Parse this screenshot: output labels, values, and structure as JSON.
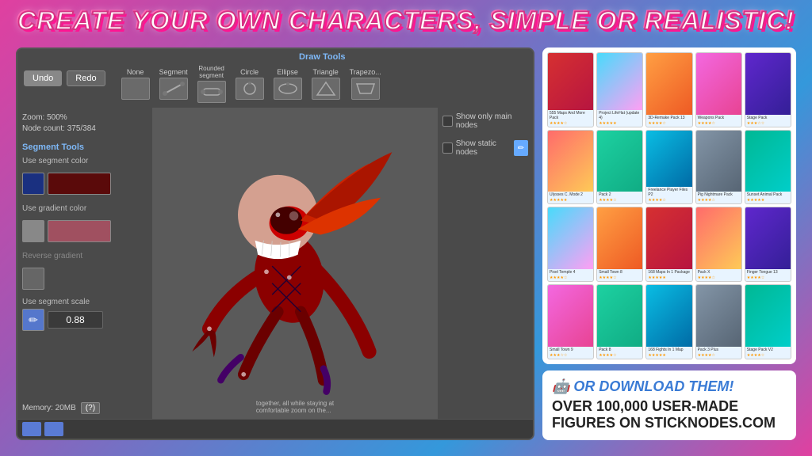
{
  "title": "CREATE YOUR OWN CHARACTERS, SIMPLE OR REALISTIC!",
  "app": {
    "toolbar": {
      "undo_label": "Undo",
      "redo_label": "Redo",
      "zoom_label": "Zoom: 500%",
      "node_count_label": "Node count: 375/384"
    },
    "draw_tools": {
      "section_label": "Draw Tools",
      "tools": [
        {
          "name": "None",
          "id": "tool-none"
        },
        {
          "name": "Segment",
          "id": "tool-segment"
        },
        {
          "name": "Rounded segment",
          "id": "tool-rounded-segment"
        },
        {
          "name": "Circle",
          "id": "tool-circle"
        },
        {
          "name": "Ellipse",
          "id": "tool-ellipse"
        },
        {
          "name": "Triangle",
          "id": "tool-triangle"
        },
        {
          "name": "Trapezoid",
          "id": "tool-trapezoid"
        }
      ]
    },
    "right_panel": {
      "show_main_nodes_label": "Show only main nodes",
      "show_static_nodes_label": "Show static nodes"
    },
    "left_panel": {
      "segment_tools_label": "Segment Tools",
      "use_segment_color_label": "Use segment color",
      "use_gradient_color_label": "Use gradient color",
      "reverse_gradient_label": "Reverse gradient",
      "use_segment_scale_label": "Use segment scale",
      "scale_value": "0.88",
      "memory_label": "Memory: 20MB",
      "help_label": "(?)"
    }
  },
  "community": {
    "download_title": "🤖 OR DOWNLOAD THEM!",
    "download_body": "OVER 100,000 USER-MADE FIGURES ON STICKNODES.COM",
    "cards": [
      {
        "title": "555 Maps And More Pack",
        "stars": "★★★★☆",
        "bg": "card-bg-9"
      },
      {
        "title": "Project LifeHat (update 4)",
        "stars": "★★★★★",
        "bg": "card-bg-2"
      },
      {
        "title": "3D-Remake Pack 13",
        "stars": "★★★★☆",
        "bg": "card-bg-5"
      },
      {
        "title": "Weapons Pack",
        "stars": "★★★★☆",
        "bg": "card-bg-7"
      },
      {
        "title": "Stage Pack",
        "stars": "★★★☆☆",
        "bg": "card-bg-4"
      },
      {
        "title": "Ulysses C. Mode 2",
        "stars": "★★★★★",
        "bg": "card-bg-1"
      },
      {
        "title": "Pack 2",
        "stars": "★★★★☆",
        "bg": "card-bg-3"
      },
      {
        "title": "Freelance Player Files P2",
        "stars": "★★★★☆",
        "bg": "card-bg-6"
      },
      {
        "title": "Pig Nightmare Pack",
        "stars": "★★★★☆",
        "bg": "card-bg-8"
      },
      {
        "title": "Sunset Animal Pack",
        "stars": "★★★★★",
        "bg": "card-bg-10"
      },
      {
        "title": "Pixel Temple 4",
        "stars": "★★★★☆",
        "bg": "card-bg-2"
      },
      {
        "title": "Small Town 8",
        "stars": "★★★★☆",
        "bg": "card-bg-5"
      },
      {
        "title": "168 Maps In 1 Package",
        "stars": "★★★★★",
        "bg": "card-bg-9"
      },
      {
        "title": "Pack X",
        "stars": "★★★★☆",
        "bg": "card-bg-1"
      },
      {
        "title": "Finger Tongue 13",
        "stars": "★★★★☆",
        "bg": "card-bg-4"
      },
      {
        "title": "Small Town 9",
        "stars": "★★★☆☆",
        "bg": "card-bg-7"
      },
      {
        "title": "Pack 8",
        "stars": "★★★★☆",
        "bg": "card-bg-3"
      },
      {
        "title": "168 Fights In 1 Map",
        "stars": "★★★★★",
        "bg": "card-bg-6"
      },
      {
        "title": "Pack 3 Plus",
        "stars": "★★★★☆",
        "bg": "card-bg-8"
      },
      {
        "title": "Stage Pack V2",
        "stars": "★★★★☆",
        "bg": "card-bg-10"
      }
    ]
  },
  "colors": {
    "accent_blue": "#7eb8f7",
    "bg_dark": "#3a3a3a",
    "bg_medium": "#4a4a4a",
    "segment_color_active": "#1a1a6a",
    "segment_color_dark_red": "#8b1a1a",
    "gradient_color_active": "#999",
    "gradient_color_pink": "#c06080",
    "pencil_btn": "#66aaff",
    "title_bg": "#e91e8c"
  }
}
